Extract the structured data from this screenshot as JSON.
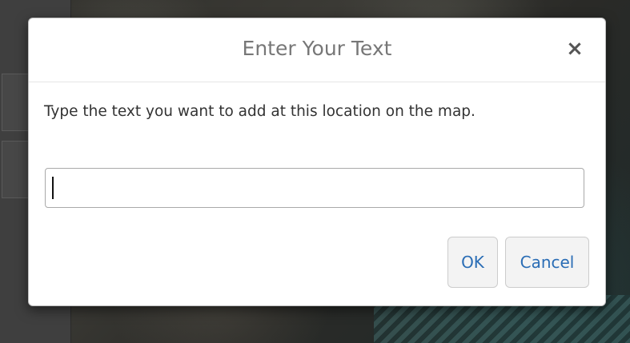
{
  "dialog": {
    "title": "Enter Your Text",
    "close_glyph": "×",
    "instruction": "Type the text you want to add at this location on the map.",
    "input_value": "",
    "input_placeholder": "",
    "ok_label": "OK",
    "cancel_label": "Cancel"
  },
  "icons": {
    "close": "close-icon"
  },
  "colors": {
    "title_text": "#777777",
    "button_text": "#2a6db5",
    "button_bg": "#f3f3f3",
    "modal_bg": "#ffffff",
    "border": "#cccccc"
  }
}
